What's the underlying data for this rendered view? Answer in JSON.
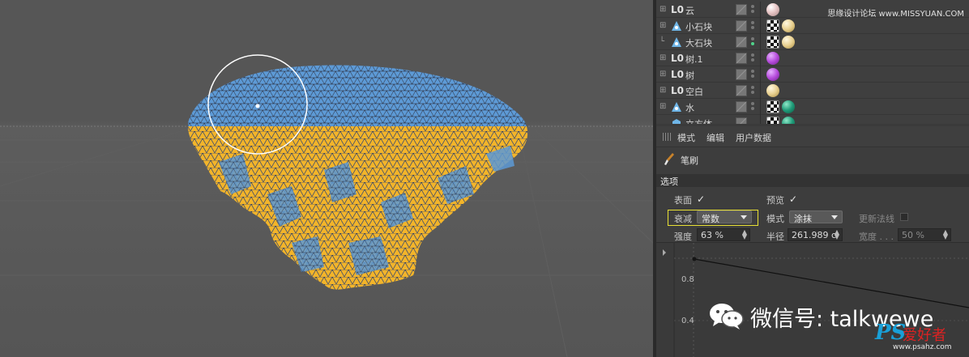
{
  "objects": {
    "brand": "思缘设计论坛 www.MISSYUAN.COM",
    "rows": [
      {
        "name": "云",
        "type": "null",
        "tree": "⊞",
        "tags": [
          "m-pink"
        ]
      },
      {
        "name": "小石块",
        "type": "poly",
        "tree": "⊞",
        "tags": [
          "checker",
          "m-cream"
        ]
      },
      {
        "name": "大石块",
        "type": "poly",
        "tree": "└",
        "tags": [
          "checker",
          "m-cream"
        ]
      },
      {
        "name": "树.1",
        "type": "null",
        "tree": "⊞",
        "tags": [
          "m-purple"
        ]
      },
      {
        "name": "树",
        "type": "null",
        "tree": "⊞",
        "tags": [
          "m-purple"
        ]
      },
      {
        "name": "空白",
        "type": "null",
        "tree": "⊞",
        "tags": [
          "m-cream"
        ]
      },
      {
        "name": "水",
        "type": "poly",
        "tree": "⊞",
        "tags": [
          "checker",
          "m-teal"
        ]
      },
      {
        "name": "立方体",
        "type": "poly",
        "tree": "",
        "tags": [
          "checker",
          "m-teal"
        ]
      }
    ]
  },
  "menu": {
    "mode": "模式",
    "edit": "编辑",
    "userdata": "用户数据"
  },
  "tool": {
    "name": "笔刷",
    "icon": "brush-icon"
  },
  "section": {
    "options": "选项"
  },
  "options": {
    "surface_label": "表面",
    "preview_label": "预览",
    "falloff_label": "衰减",
    "falloff_value": "常数",
    "mode_label": "模式",
    "mode_value": "涂抹",
    "update_normals_label": "更新法线",
    "strength_label": "强度",
    "strength_value": "63 %",
    "radius_label": "半径",
    "radius_value": "261.989 c",
    "width_label": "宽度 . . .",
    "width_value": "50 %"
  },
  "graph": {
    "labels": [
      "0.8",
      "0.4"
    ]
  },
  "watermark": {
    "wechat": "微信号: talkwewe",
    "ps": "PS",
    "ps_cn": "爱好者",
    "ps_url": "www.psahz.com"
  },
  "colors": {
    "mesh_top": "#5d9ad6",
    "mesh_side": "#f2b42a",
    "selection_highlight": "#e8e034"
  }
}
